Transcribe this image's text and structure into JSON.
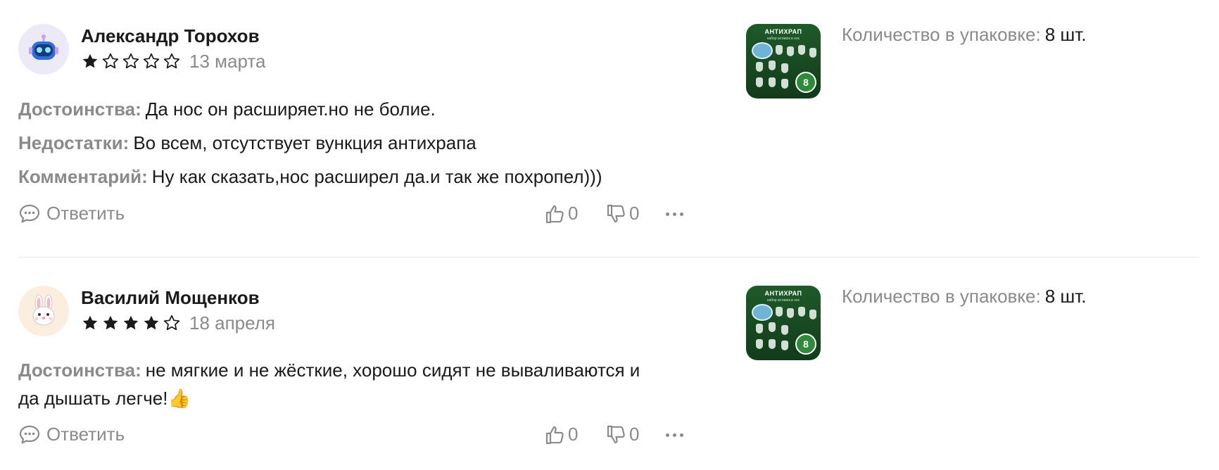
{
  "reviews": [
    {
      "author": "Александр Торохов",
      "avatar": "robot-avatar",
      "rating": 1,
      "rating_max": 5,
      "date": "13 марта",
      "pros_label": "Достоинства:",
      "pros": "Да нос он расширяет.но не болие.",
      "cons_label": "Недостатки:",
      "cons": "Во всем, отсутствует вункция антихрапа",
      "comment_label": "Комментарий:",
      "comment": "Ну как сказать,нос расширел да.и так же похропел)))",
      "reply_label": "Ответить",
      "likes": "0",
      "dislikes": "0",
      "pack_label": "Количество в упаковке:",
      "pack_value": "8 шт.",
      "product_title": "АНТИХРАП",
      "product_sub": "набор вставок в нос",
      "product_badge": "8"
    },
    {
      "author": "Василий Мощенков",
      "avatar": "bunny-avatar",
      "rating": 4,
      "rating_max": 5,
      "date": "18 апреля",
      "pros_label": "Достоинства:",
      "pros_line1": "не мягкие и не жёсткие, хорошо сидят не вываливаются и",
      "pros_line2": "да дышать легче!👍",
      "reply_label": "Ответить",
      "likes": "0",
      "dislikes": "0",
      "pack_label": "Количество в упаковке:",
      "pack_value": "8 шт.",
      "product_title": "АНТИХРАП",
      "product_sub": "набор вставок в нос",
      "product_badge": "8"
    }
  ],
  "colors": {
    "text": "#1a1a1a",
    "muted": "#8a8a8a",
    "star": "#1a1a1a",
    "divider": "#e7e7e7",
    "product_bg": "#1f5a2a"
  }
}
